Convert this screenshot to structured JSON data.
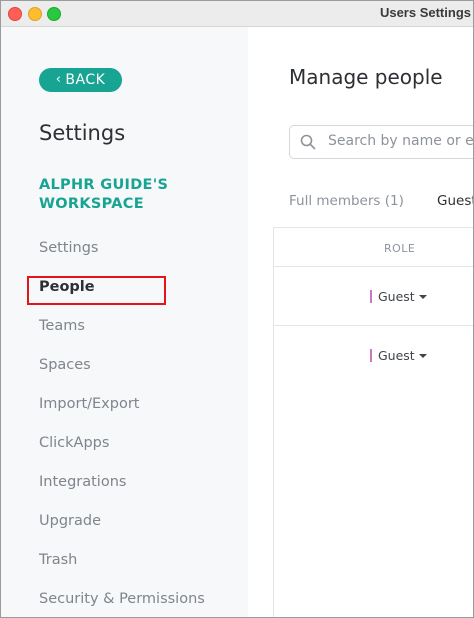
{
  "window": {
    "title": "Users Settings"
  },
  "sidebar": {
    "back_label": "BACK",
    "title": "Settings",
    "workspace_name": "ALPHR GUIDE'S WORKSPACE",
    "items": [
      {
        "label": "Settings"
      },
      {
        "label": "People",
        "active": true
      },
      {
        "label": "Teams"
      },
      {
        "label": "Spaces"
      },
      {
        "label": "Import/Export"
      },
      {
        "label": "ClickApps"
      },
      {
        "label": "Integrations"
      },
      {
        "label": "Upgrade"
      },
      {
        "label": "Trash"
      },
      {
        "label": "Security & Permissions"
      }
    ]
  },
  "main": {
    "title": "Manage people",
    "search": {
      "placeholder": "Search by name or email"
    },
    "tabs": [
      {
        "label": "Full members (1)"
      },
      {
        "label": "Guests"
      }
    ],
    "table": {
      "role_header": "ROLE",
      "rows": [
        {
          "role": "Guest"
        },
        {
          "role": "Guest"
        }
      ]
    }
  },
  "colors": {
    "accent": "#17a493",
    "highlight": "#e5131a",
    "role_marker": "#c879c2"
  }
}
